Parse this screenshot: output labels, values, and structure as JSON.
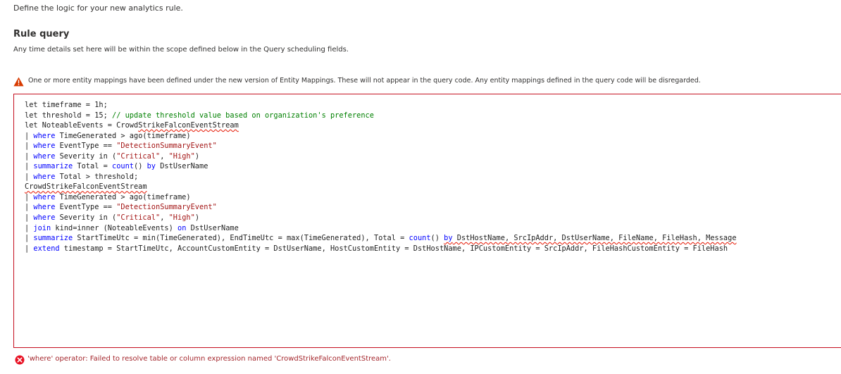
{
  "intro": "Define the logic for your new analytics rule.",
  "section": {
    "title": "Rule query",
    "description": "Any time details set here will be within the scope defined below in the Query scheduling fields."
  },
  "warning": {
    "icon": "warning-triangle-icon",
    "text": "One or more entity mappings have been defined under the new version of Entity Mappings. These will not appear in the query code. Any entity mappings defined in the query code will be disregarded.",
    "icon_color": "#d83b01"
  },
  "editor": {
    "border_color": "#c50f1f",
    "lines": [
      [
        {
          "t": "let timeframe = 1h;"
        }
      ],
      [
        {
          "t": "let threshold = 15; "
        },
        {
          "t": "// update threshold value based on organization's preference",
          "c": "cmt"
        }
      ],
      [
        {
          "t": "let NoteableEvents = Crowd"
        },
        {
          "t": "StrikeFalconEventStream",
          "c": "squig"
        }
      ],
      [
        {
          "t": "| "
        },
        {
          "t": "where",
          "c": "kw"
        },
        {
          "t": " TimeGenerated > ago(timeframe)"
        }
      ],
      [
        {
          "t": "| "
        },
        {
          "t": "where",
          "c": "kw"
        },
        {
          "t": " EventType == "
        },
        {
          "t": "\"DetectionSummaryEvent\"",
          "c": "str"
        }
      ],
      [
        {
          "t": "| "
        },
        {
          "t": "where",
          "c": "kw"
        },
        {
          "t": " Severity in ("
        },
        {
          "t": "\"Critical\"",
          "c": "str"
        },
        {
          "t": ", "
        },
        {
          "t": "\"High\"",
          "c": "str"
        },
        {
          "t": ")"
        }
      ],
      [
        {
          "t": "| "
        },
        {
          "t": "summarize",
          "c": "kw"
        },
        {
          "t": " Total = "
        },
        {
          "t": "count",
          "c": "kw"
        },
        {
          "t": "() "
        },
        {
          "t": "by",
          "c": "kw"
        },
        {
          "t": " DstUserName"
        }
      ],
      [
        {
          "t": "| "
        },
        {
          "t": "where",
          "c": "kw"
        },
        {
          "t": " Total > threshold;"
        }
      ],
      [
        {
          "t": "CrowdStrikeFalconEventStream",
          "c": "squig"
        }
      ],
      [
        {
          "t": "| "
        },
        {
          "t": "where",
          "c": "kw"
        },
        {
          "t": " TimeGenerated > ago(timeframe)"
        }
      ],
      [
        {
          "t": "| "
        },
        {
          "t": "where",
          "c": "kw"
        },
        {
          "t": " EventType == "
        },
        {
          "t": "\"DetectionSummaryEvent\"",
          "c": "str"
        }
      ],
      [
        {
          "t": "| "
        },
        {
          "t": "where",
          "c": "kw"
        },
        {
          "t": " Severity in ("
        },
        {
          "t": "\"Critical\"",
          "c": "str"
        },
        {
          "t": ", "
        },
        {
          "t": "\"High\"",
          "c": "str"
        },
        {
          "t": ")"
        }
      ],
      [
        {
          "t": "| "
        },
        {
          "t": "join",
          "c": "kw"
        },
        {
          "t": " kind=inner (NoteableEvents) "
        },
        {
          "t": "on",
          "c": "kw"
        },
        {
          "t": " DstUserName"
        }
      ],
      [
        {
          "t": "| "
        },
        {
          "t": "summarize",
          "c": "kw"
        },
        {
          "t": " StartTimeUtc = min(TimeGenerated), EndTimeUtc = max(TimeGenerated), Total = "
        },
        {
          "t": "count",
          "c": "kw"
        },
        {
          "t": "() "
        },
        {
          "t": "by",
          "c": "kw squig"
        },
        {
          "t": " DstHostName, SrcIpAddr, DstUserName, FileName, FileHash, Message",
          "c": "squig"
        }
      ],
      [
        {
          "t": "| "
        },
        {
          "t": "extend",
          "c": "kw"
        },
        {
          "t": " timestamp = StartTimeUtc, AccountCustomEntity = DstUserName, HostCustomEntity = DstHostName, IPCustomEntity = SrcIpAddr, FileHashCustomEntity = FileHash"
        }
      ]
    ]
  },
  "error": {
    "icon": "error-circle-icon",
    "text": "'where' operator: Failed to resolve table or column expression named 'CrowdStrikeFalconEventStream'.",
    "icon_color": "#e81123"
  }
}
